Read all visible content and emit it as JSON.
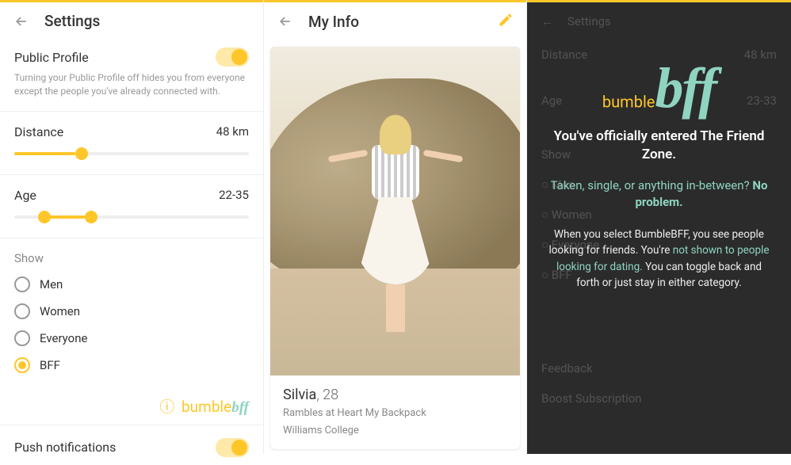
{
  "colors": {
    "accent": "#ffc629",
    "mint": "#8fd4c1"
  },
  "pane1": {
    "title": "Settings",
    "publicProfile": {
      "label": "Public Profile",
      "desc": "Turning your Public Profile off hides you from everyone except the people you've already connected with.",
      "on": true
    },
    "distance": {
      "label": "Distance",
      "value": "48 km",
      "fillPct": 26
    },
    "age": {
      "label": "Age",
      "value": "22-35",
      "lowPct": 10,
      "highPct": 30
    },
    "show": {
      "title": "Show",
      "options": [
        "Men",
        "Women",
        "Everyone",
        "BFF"
      ],
      "selected": "BFF"
    },
    "bffLogo": {
      "q": "?",
      "brand": "bumble",
      "suffix": "bff"
    },
    "push": {
      "label": "Push notifications",
      "on": true
    }
  },
  "pane2": {
    "title": "My Info",
    "card": {
      "name": "Silvia",
      "age": ", 28",
      "line1": "Rambles at Heart My Backpack",
      "line2": "Williams College"
    }
  },
  "pane3": {
    "bg": {
      "title": "Settings",
      "distance": {
        "label": "Distance",
        "value": "48 km"
      },
      "age": {
        "label": "Age",
        "value": "23-33"
      },
      "show": "Show",
      "opts": [
        "Men",
        "Women",
        "Everyone",
        "BFF"
      ],
      "feedback": "Feedback",
      "boost": "Boost Subscription"
    },
    "logo": {
      "brand": "bumble",
      "suffix": "bff"
    },
    "h1": "You've officially entered The Friend Zone.",
    "h2a": "Taken, single, or anything in-between? ",
    "h2b": "No problem.",
    "body1": "When you select BumbleBFF, you see people looking for friends. You're ",
    "bodyHl": "not shown to people looking for dating.",
    "body2": " You can toggle back and forth or just stay in either category."
  }
}
